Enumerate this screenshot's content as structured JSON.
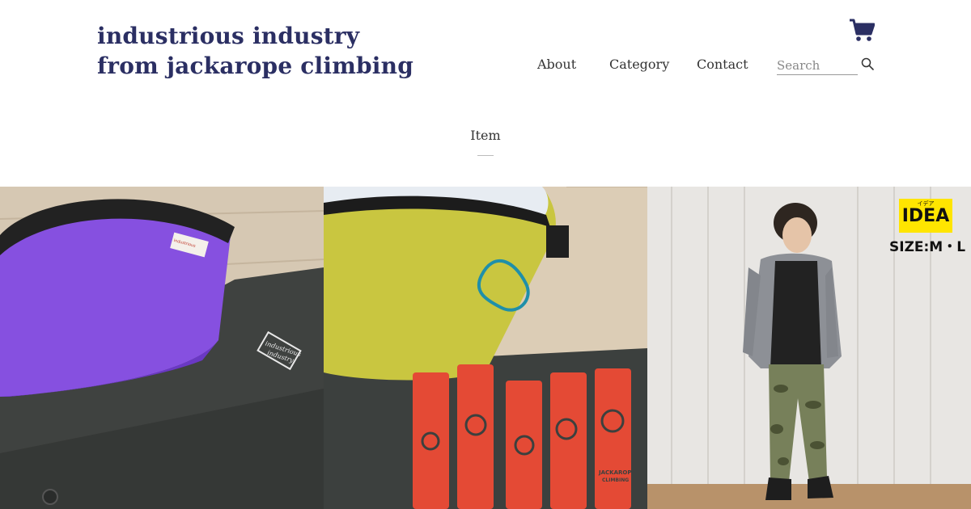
{
  "header": {
    "logo_line1": "industrious industry",
    "logo_line2": "from jackarope climbing",
    "cart_icon": "cart-icon"
  },
  "nav": {
    "items": [
      {
        "label": "About"
      },
      {
        "label": "Category"
      },
      {
        "label": "Contact"
      }
    ],
    "search_placeholder": "Search",
    "search_value": "",
    "search_icon": "search-icon"
  },
  "section": {
    "title": "Item"
  },
  "items": [
    {
      "logo_text_1": "industrious",
      "logo_text_2": "industry"
    },
    {
      "mark_text_1": "JACKAROPE",
      "mark_text_2": "CLIMBING"
    },
    {
      "badge_ruby": "イデア",
      "badge_word": "IDEA",
      "size_label": "SIZE:M・L"
    }
  ],
  "colors": {
    "brand_navy": "#2b2f63",
    "text": "#333333",
    "badge_yellow": "#ffe500"
  }
}
